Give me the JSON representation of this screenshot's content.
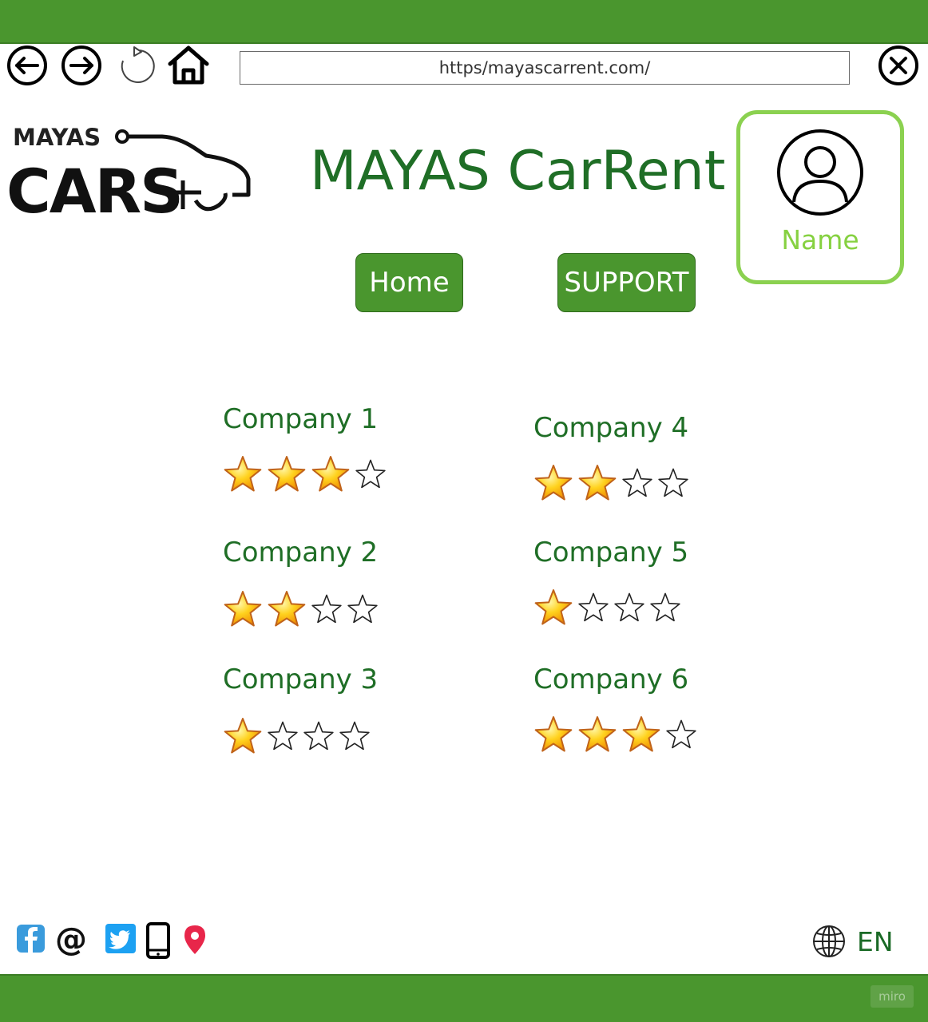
{
  "browser": {
    "url": "https/mayascarrent.com/",
    "icons": [
      "back-arrow-icon",
      "forward-arrow-icon",
      "reload-icon",
      "home-icon",
      "close-icon"
    ]
  },
  "logo": {
    "line1": "MAYAS",
    "line2": "CARS"
  },
  "header": {
    "title": "MAYAS CarRent"
  },
  "profile": {
    "name": "Name",
    "icon": "user-avatar-icon"
  },
  "nav": {
    "home_label": "Home",
    "support_label": "SUPPORT"
  },
  "companies": [
    {
      "name": "Company 1",
      "rating": 3,
      "max": 4
    },
    {
      "name": "Company 2",
      "rating": 2,
      "max": 4
    },
    {
      "name": "Company 3",
      "rating": 1,
      "max": 4
    },
    {
      "name": "Company 4",
      "rating": 2,
      "max": 4
    },
    {
      "name": "Company 5",
      "rating": 1,
      "max": 4
    },
    {
      "name": "Company 6",
      "rating": 3,
      "max": 4
    }
  ],
  "footer": {
    "social_icons": [
      "facebook-icon",
      "email-at-icon",
      "twitter-icon",
      "phone-icon",
      "location-pin-icon"
    ],
    "language": "EN",
    "watermark": "miro"
  },
  "colors": {
    "bar_green": "#4a962e",
    "title_green": "#1f6e26",
    "profile_green": "#8bd150"
  }
}
